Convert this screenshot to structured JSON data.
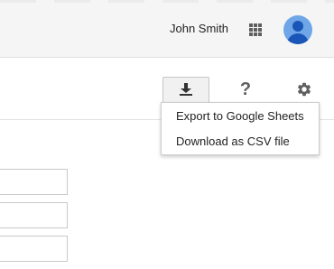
{
  "header": {
    "user_name": "John Smith",
    "apps_icon": "apps-grid-icon",
    "avatar_icon": "account-avatar-icon",
    "avatar_color": "#6ea6e8"
  },
  "toolbar": {
    "download_icon": "download-icon",
    "help_label": "?",
    "settings_icon": "gear-icon"
  },
  "download_menu": {
    "items": [
      {
        "label": "Export to Google Sheets"
      },
      {
        "label": "Download as CSV file"
      }
    ]
  },
  "form": {
    "fields": [
      {
        "value": ""
      },
      {
        "value": ""
      },
      {
        "value": ""
      }
    ]
  }
}
